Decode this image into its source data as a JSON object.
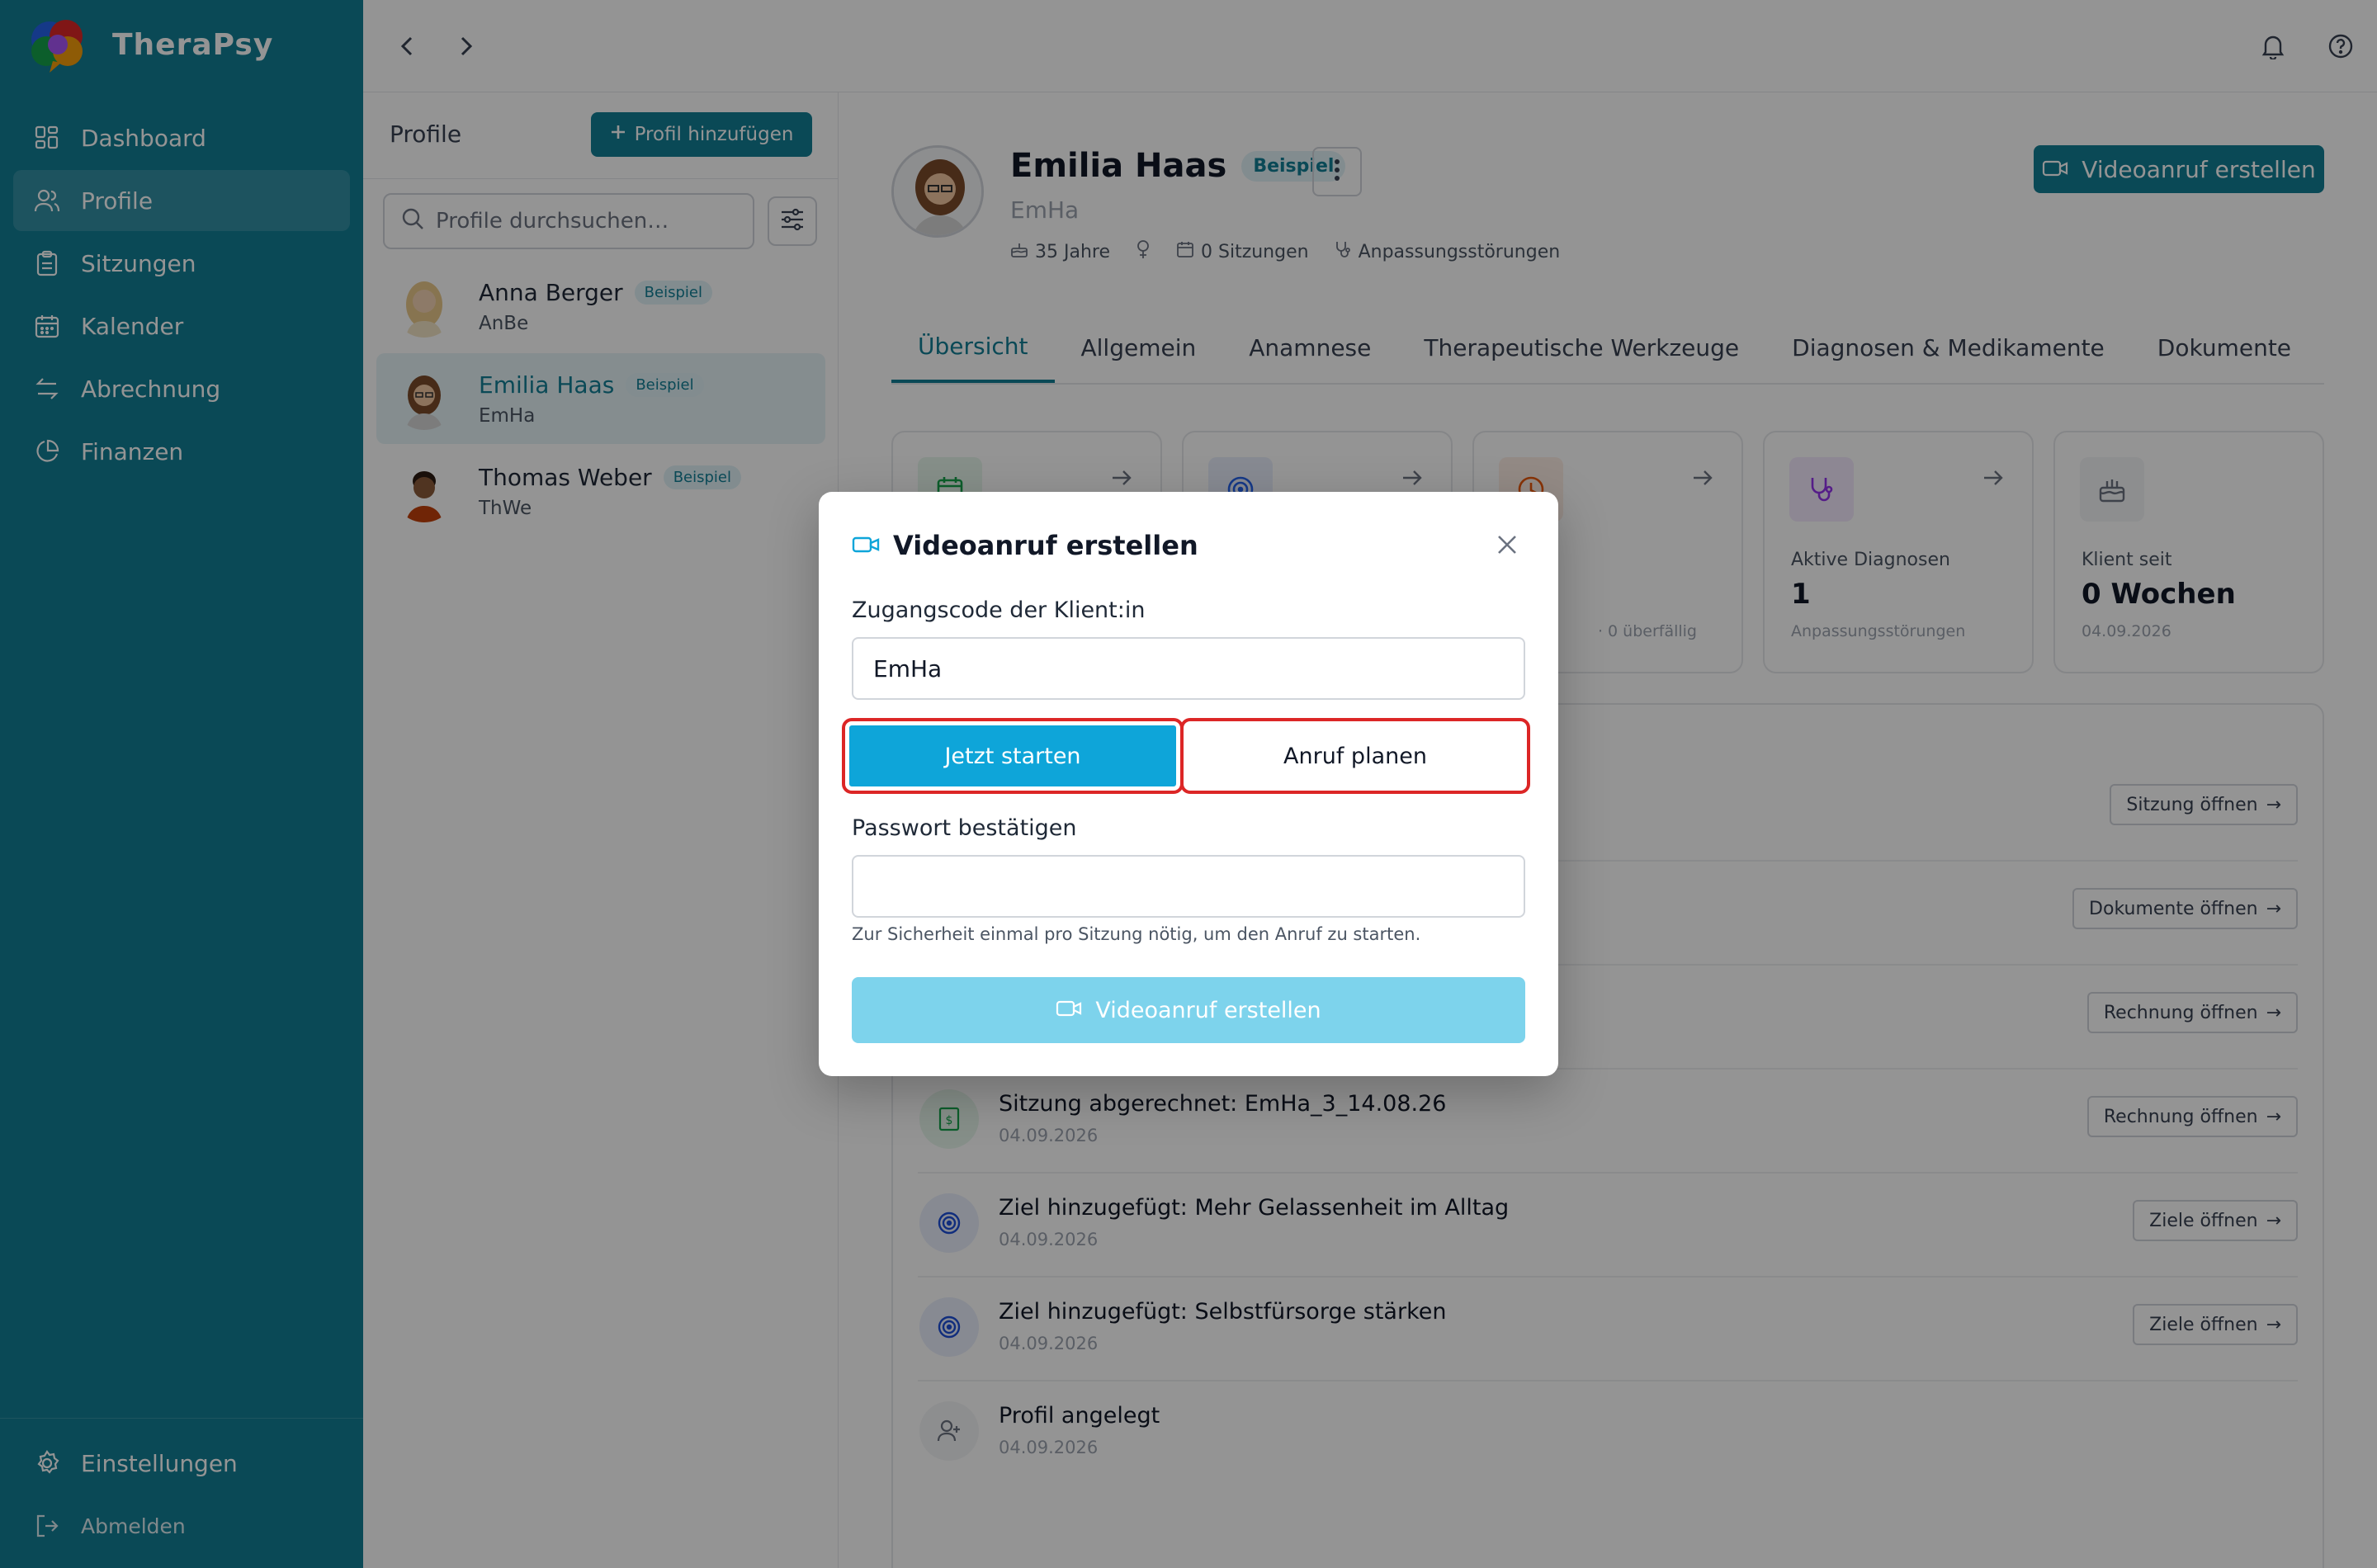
{
  "app": {
    "name": "TheraPsy"
  },
  "sidebar": {
    "items": [
      {
        "label": "Dashboard",
        "icon": "dashboard-icon"
      },
      {
        "label": "Profile",
        "icon": "users-icon",
        "active": true
      },
      {
        "label": "Sitzungen",
        "icon": "clipboard-icon"
      },
      {
        "label": "Kalender",
        "icon": "calendar-icon"
      },
      {
        "label": "Abrechnung",
        "icon": "exchange-icon"
      },
      {
        "label": "Finanzen",
        "icon": "pie-chart-icon"
      }
    ],
    "settings_label": "Einstellungen",
    "logout_label": "Abmelden"
  },
  "profile_list": {
    "title": "Profile",
    "add_label": "Profil hinzufügen",
    "search_placeholder": "Profile durchsuchen…",
    "profiles": [
      {
        "name": "Anna Berger",
        "code": "AnBe",
        "badge": "Beispiel"
      },
      {
        "name": "Emilia Haas",
        "code": "EmHa",
        "badge": "Beispiel",
        "active": true
      },
      {
        "name": "Thomas Weber",
        "code": "ThWe",
        "badge": "Beispiel"
      }
    ]
  },
  "profile": {
    "name": "Emilia Haas",
    "badge": "Beispiel",
    "code": "EmHa",
    "age": "35 Jahre",
    "sessions": "0 Sitzungen",
    "diagnosis": "Anpassungsstörungen",
    "video_button": "Videoanruf erstellen"
  },
  "tabs": [
    "Übersicht",
    "Allgemein",
    "Anamnese",
    "Therapeutische Werkzeuge",
    "Diagnosen & Medikamente",
    "Dokumente"
  ],
  "cards": [
    {
      "label": "",
      "value": "",
      "sub": ""
    },
    {
      "label": "",
      "value": "",
      "sub": ""
    },
    {
      "label": "",
      "value": "",
      "sub": "· 0 überfällig"
    },
    {
      "label": "Aktive Diagnosen",
      "value": "1",
      "sub": "Anpassungsstörungen"
    },
    {
      "label": "Klient seit",
      "value": "0 Wochen",
      "sub": "04.09.2026"
    }
  ],
  "activity": [
    {
      "title": "",
      "date": "",
      "button": "Sitzung öffnen"
    },
    {
      "title": "",
      "date": "",
      "button": "Dokumente öffnen"
    },
    {
      "title": "",
      "date": "",
      "button": "Rechnung öffnen"
    },
    {
      "title": "Sitzung abgerechnet: EmHa_3_14.08.26",
      "date": "04.09.2026",
      "button": "Rechnung öffnen"
    },
    {
      "title": "Ziel hinzugefügt: Mehr Gelassenheit im Alltag",
      "date": "04.09.2026",
      "button": "Ziele öffnen"
    },
    {
      "title": "Ziel hinzugefügt: Selbstfürsorge stärken",
      "date": "04.09.2026",
      "button": "Ziele öffnen"
    },
    {
      "title": "Profil angelegt",
      "date": "04.09.2026",
      "button": ""
    }
  ],
  "modal": {
    "title": "Videoanruf erstellen",
    "access_code_label": "Zugangscode der Klient:in",
    "access_code_value": "EmHa",
    "start_now": "Jetzt starten",
    "schedule": "Anruf planen",
    "password_label": "Passwort bestätigen",
    "password_value": "",
    "hint": "Zur Sicherheit einmal pro Sitzung nötig, um den Anruf zu starten.",
    "submit": "Videoanruf erstellen"
  },
  "colors": {
    "brand": "#127e95",
    "primary_button": "#0ea5d9",
    "highlight": "#dc2626"
  }
}
